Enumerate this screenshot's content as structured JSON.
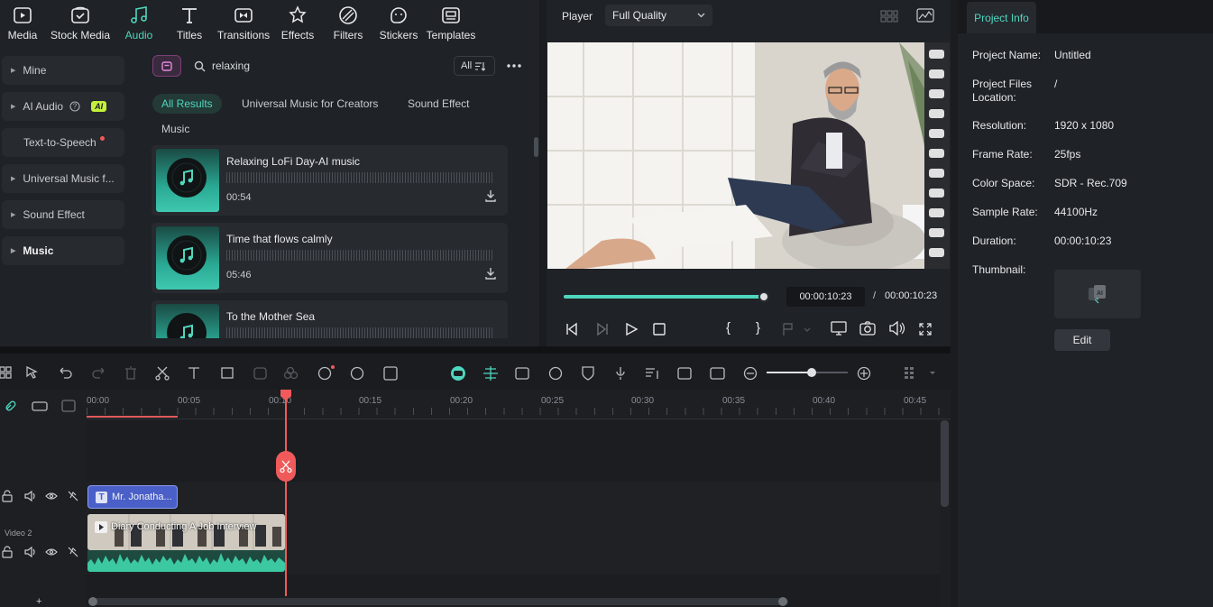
{
  "nav": {
    "tabs": [
      {
        "label": "Media",
        "icon": "media-icon",
        "active": false
      },
      {
        "label": "Stock Media",
        "icon": "stock-media-icon",
        "active": false
      },
      {
        "label": "Audio",
        "icon": "music-note-icon",
        "active": true
      },
      {
        "label": "Titles",
        "icon": "text-t-icon",
        "active": false
      },
      {
        "label": "Transitions",
        "icon": "transitions-icon",
        "active": false
      },
      {
        "label": "Effects",
        "icon": "effects-icon",
        "active": false
      },
      {
        "label": "Filters",
        "icon": "filters-icon",
        "active": false
      },
      {
        "label": "Stickers",
        "icon": "stickers-icon",
        "active": false
      },
      {
        "label": "Templates",
        "icon": "templates-icon",
        "active": false
      }
    ]
  },
  "sidebar": {
    "items": [
      {
        "label": "Mine"
      },
      {
        "label": "AI Audio",
        "badge": "AI"
      },
      {
        "label": "Text-to-Speech"
      },
      {
        "label": "Universal Music f..."
      },
      {
        "label": "Sound Effect"
      },
      {
        "label": "Music"
      }
    ]
  },
  "search": {
    "value": "relaxing",
    "filter_label": "All"
  },
  "filters": {
    "all": "All Results",
    "umc": "Universal Music for Creators",
    "sfx": "Sound Effect"
  },
  "section_label": "Music",
  "tracks": [
    {
      "title": "Relaxing LoFi Day-AI music",
      "duration": "00:54"
    },
    {
      "title": "Time that flows calmly",
      "duration": "05:46"
    },
    {
      "title": "To the Mother Sea",
      "duration": ""
    }
  ],
  "player": {
    "label": "Player",
    "quality": "Full Quality",
    "current_time": "00:00:10:23",
    "separator": "/",
    "total_time": "00:00:10:23",
    "progress": 0.99
  },
  "project_info": {
    "tab": "Project Info",
    "rows": [
      {
        "label": "Project Name:",
        "value": "Untitled"
      },
      {
        "label": "Project Files",
        "label2": "Location:",
        "value": "/"
      },
      {
        "label": "Resolution:",
        "value": "1920 x 1080"
      },
      {
        "label": "Frame Rate:",
        "value": "25fps"
      },
      {
        "label": "Color Space:",
        "value": "SDR - Rec.709"
      },
      {
        "label": "Sample Rate:",
        "value": "44100Hz"
      },
      {
        "label": "Duration:",
        "value": "00:00:10:23"
      },
      {
        "label": "Thumbnail:",
        "value": ""
      }
    ],
    "edit_label": "Edit"
  },
  "timeline": {
    "ticks": [
      "00:00",
      "00:05",
      "00:10",
      "00:15",
      "00:20",
      "00:25",
      "00:30",
      "00:35",
      "00:40",
      "00:45"
    ],
    "title_clip": "Mr. Jonatha...",
    "video_clip": "Diary Conducting A Job Interview",
    "track_label": "Video 2",
    "zoom_level": 0.55
  },
  "colors": {
    "accent": "#4fd6be",
    "playhead": "#f05a5a",
    "title_clip": "#4a5fc7",
    "audio_wave": "#3cc9a2"
  }
}
